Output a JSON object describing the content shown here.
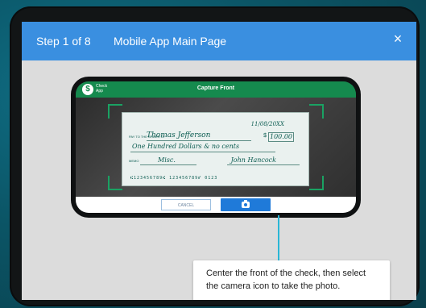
{
  "modal": {
    "step": "Step 1 of 8",
    "title": "Mobile App Main Page",
    "close": "×"
  },
  "phone_app": {
    "brand": "Check App",
    "title": "Capture Front",
    "cancel_label": "CANCEL",
    "capture_icon": "camera-icon",
    "accent_color": "#158a4e",
    "button_color": "#1f7ad9"
  },
  "check": {
    "date": "11/08/20XX",
    "pay_to_label": "PAY TO THE ORDER OF",
    "payee": "Thomas Jefferson",
    "amount": "100.00",
    "amount_words": "One Hundred Dollars & no cents",
    "memo_label": "MEMO",
    "memo": "Misc.",
    "signature": "John Hancock",
    "micr": "⑆123456789⑆ 123456789⑈ 0123"
  },
  "tooltip": {
    "line1": "Center the front of the check, then select",
    "line2": "the camera icon to take the photo."
  }
}
